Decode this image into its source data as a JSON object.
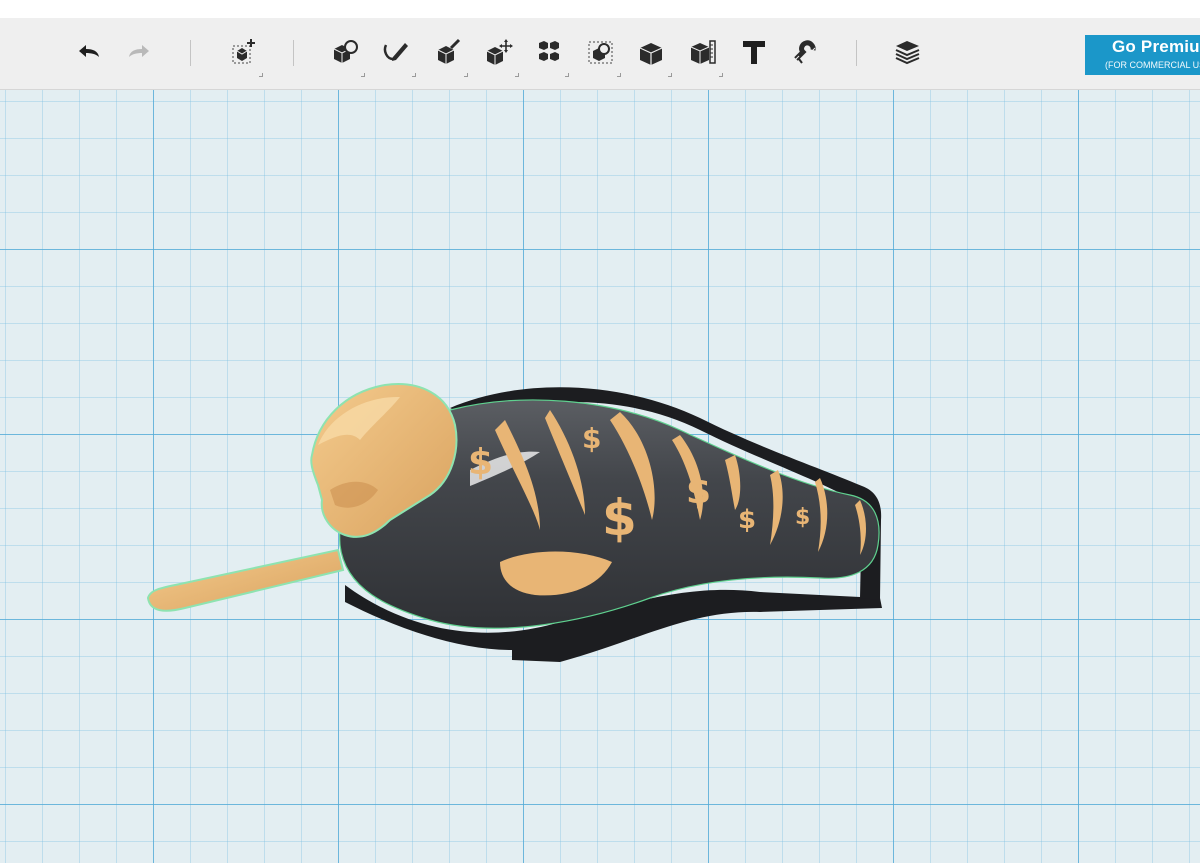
{
  "toolbar": {
    "undo_icon": "undo-arrow-icon",
    "redo_icon": "redo-arrow-icon",
    "tools": [
      {
        "name": "primitives",
        "icon": "add-primitive-cube-icon"
      },
      {
        "name": "transform",
        "icon": "transform-cube-icon"
      },
      {
        "name": "sketch",
        "icon": "sketch-pencil-icon"
      },
      {
        "name": "construct",
        "icon": "construct-extrude-icon"
      },
      {
        "name": "modify",
        "icon": "modify-move-icon"
      },
      {
        "name": "pattern",
        "icon": "pattern-grid-icon"
      },
      {
        "name": "grouping",
        "icon": "group-selection-icon"
      },
      {
        "name": "combine",
        "icon": "combine-cube-icon"
      },
      {
        "name": "measure",
        "icon": "measure-ruler-icon"
      },
      {
        "name": "text",
        "icon": "text-t-icon"
      },
      {
        "name": "snap",
        "icon": "snap-magnet-icon"
      },
      {
        "name": "material",
        "icon": "material-layers-icon"
      }
    ]
  },
  "premium": {
    "label": "Go Premium",
    "sublabel": "(FOR COMMERCIAL USE)"
  },
  "colors": {
    "accent": "#1b97c9",
    "grid_major": "#50aad7",
    "grid_background": "#e3eef2",
    "model_body": "#3f4247",
    "model_highlight": "#e8b575",
    "selection_glow": "#5fd18f"
  },
  "model": {
    "symbols": [
      "$",
      "$",
      "$",
      "$",
      "$",
      "$"
    ]
  }
}
